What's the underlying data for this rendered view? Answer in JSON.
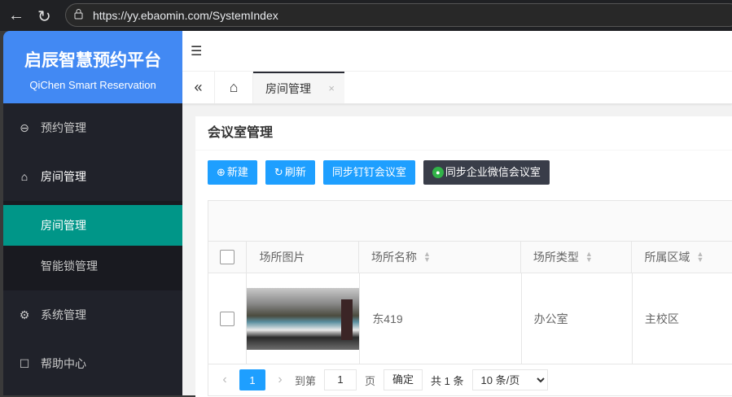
{
  "browser": {
    "url": "https://yy.ebaomin.com/SystemIndex",
    "back_icon": "arrow-left",
    "reload_icon": "reload"
  },
  "sidebar": {
    "title": "启辰智慧预约平台",
    "subtitle": "QiChen Smart Reservation",
    "items": [
      {
        "label": "预约管理",
        "icon": "chat-icon"
      },
      {
        "label": "房间管理",
        "icon": "home-icon",
        "children": [
          {
            "label": "房间管理",
            "active": true
          },
          {
            "label": "智能锁管理"
          }
        ]
      },
      {
        "label": "系统管理",
        "icon": "gear-icon"
      },
      {
        "label": "帮助中心",
        "icon": "help-icon"
      }
    ],
    "active_color": "#009688",
    "brand_color": "#4289f3"
  },
  "tabs": [
    {
      "label": "房间管理",
      "close": "×"
    }
  ],
  "card": {
    "title": "会议室管理",
    "buttons": {
      "new": "新建",
      "refresh": "刷新",
      "sync_dingtalk": "同步钉钉会议室",
      "sync_wecom": "同步企业微信会议室"
    },
    "table": {
      "columns": [
        "场所图片",
        "场所名称",
        "场所类型",
        "所属区域"
      ],
      "rows": [
        {
          "name": "东419",
          "type": "办公室",
          "area": "主校区"
        }
      ]
    },
    "pagination": {
      "current": "1",
      "goto_label": "到第",
      "goto_value": "1",
      "page_label": "页",
      "confirm": "确定",
      "total": "共 1 条",
      "page_size": "10 条/页"
    }
  }
}
